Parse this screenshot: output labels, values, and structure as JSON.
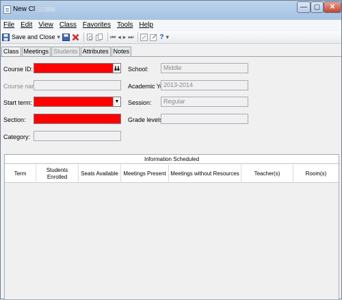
{
  "window": {
    "title": "New Class",
    "minimize": "—",
    "maximize": "▢",
    "close": "✕"
  },
  "menu": [
    "File",
    "Edit",
    "View",
    "Class",
    "Favorites",
    "Tools",
    "Help"
  ],
  "toolbar": {
    "save_close_label": "Save and Close"
  },
  "tabs": [
    {
      "label": "Class",
      "active": true,
      "enabled": true
    },
    {
      "label": "Meetings",
      "active": false,
      "enabled": true
    },
    {
      "label": "Students",
      "active": false,
      "enabled": false
    },
    {
      "label": "Attributes",
      "active": false,
      "enabled": true
    },
    {
      "label": "Notes",
      "active": false,
      "enabled": true
    }
  ],
  "form": {
    "course_id": {
      "label": "Course ID:",
      "value": ""
    },
    "course_name": {
      "label": "Course name:",
      "value": ""
    },
    "start_term": {
      "label": "Start term:",
      "value": ""
    },
    "section": {
      "label": "Section:",
      "value": ""
    },
    "category": {
      "label": "Category:",
      "value": ""
    },
    "school": {
      "label": "School:",
      "value": "Middle"
    },
    "academic_year": {
      "label": "Academic Year:",
      "value": "2013-2014"
    },
    "session": {
      "label": "Session:",
      "value": "Regular"
    },
    "grade_levels": {
      "label": "Grade levels:",
      "value": ""
    }
  },
  "colors": {
    "required_field": "#ff0000",
    "titlebar": "#bcd3ec"
  },
  "schedule": {
    "title": "Information Scheduled",
    "columns": [
      "Term",
      "Students Enrolled",
      "Seats Available",
      "Meetings Present",
      "Meetings without Resources",
      "Teacher(s)",
      "Room(s)"
    ],
    "rows": []
  }
}
